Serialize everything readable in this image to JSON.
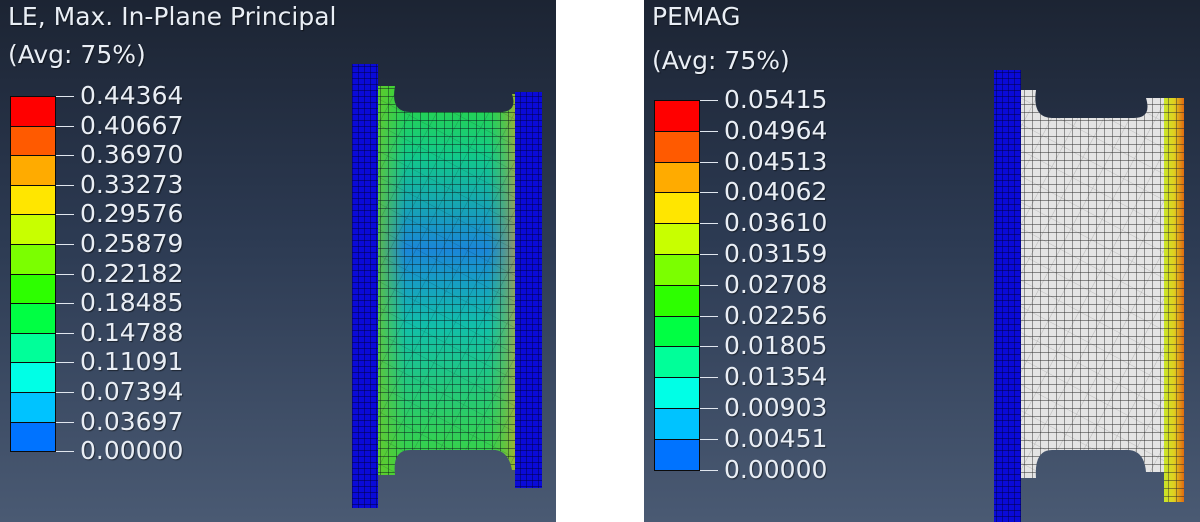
{
  "panels": [
    {
      "title": "LE, Max. In-Plane Principal",
      "subtitle": "(Avg: 75%)",
      "legend": [
        "0.44364",
        "0.40667",
        "0.36970",
        "0.33273",
        "0.29576",
        "0.25879",
        "0.22182",
        "0.18485",
        "0.14788",
        "0.11091",
        "0.07394",
        "0.03697",
        "0.00000"
      ],
      "colors": [
        "#ff0000",
        "#ff5a00",
        "#ffab00",
        "#ffe600",
        "#c8ff00",
        "#7bff00",
        "#2dff00",
        "#00ff43",
        "#00ff99",
        "#00ffe6",
        "#00c3ff",
        "#0073ff",
        "#0000ff"
      ]
    },
    {
      "title": "PEMAG",
      "subtitle": "(Avg: 75%)",
      "legend": [
        "0.05415",
        "0.04964",
        "0.04513",
        "0.04062",
        "0.03610",
        "0.03159",
        "0.02708",
        "0.02256",
        "0.01805",
        "0.01354",
        "0.00903",
        "0.00451",
        "0.00000"
      ],
      "colors": [
        "#ff0000",
        "#ff5a00",
        "#ffab00",
        "#ffe600",
        "#c8ff00",
        "#7bff00",
        "#2dff00",
        "#00ff43",
        "#00ff99",
        "#00ffe6",
        "#00c3ff",
        "#0073ff",
        "#0000ff"
      ]
    }
  ]
}
